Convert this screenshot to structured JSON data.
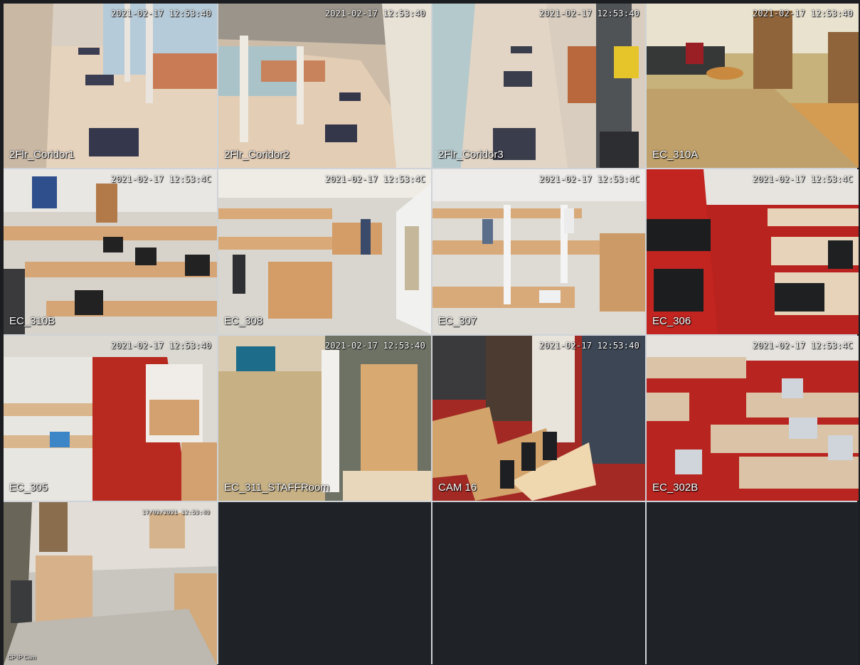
{
  "tiles": [
    {
      "label": "2Flr_Coridor1",
      "timestamp": "2021-02-17 12:53:40"
    },
    {
      "label": "2Flr_Coridor2",
      "timestamp": "2021-02-17 12:53:40"
    },
    {
      "label": "2Flr_Coridor3",
      "timestamp": "2021-02-17 12:53:40"
    },
    {
      "label": "EC_310A",
      "timestamp": "2021-02-17 12:53:40"
    },
    {
      "label": "EC_310B",
      "timestamp": "2021-02-17 12:53:4C"
    },
    {
      "label": "EC_308",
      "timestamp": "2021-02-17 12:53:4C"
    },
    {
      "label": "EC_307",
      "timestamp": "2021-02-17 12:53:4C"
    },
    {
      "label": "EC_306",
      "timestamp": "2021-02-17 12:53:4C"
    },
    {
      "label": "EC_305",
      "timestamp": "2021-02-17 12:53:40"
    },
    {
      "label": "EC_311_STAFFRoom",
      "timestamp": "2021-02-17 12:53:40"
    },
    {
      "label": "CAM 16",
      "timestamp": "2021-02-17 12:53:40"
    },
    {
      "label": "EC_302B",
      "timestamp": "2021-02-17 12:53:4C"
    },
    {
      "label": "CP IP Cam",
      "timestamp": "17/02/2021 12:53:40"
    }
  ],
  "colors": {
    "background": "#1b1d21",
    "grid_line": "#cfd3d7",
    "empty_tile": "#1f2227",
    "overlay_text": "#ffffff"
  }
}
